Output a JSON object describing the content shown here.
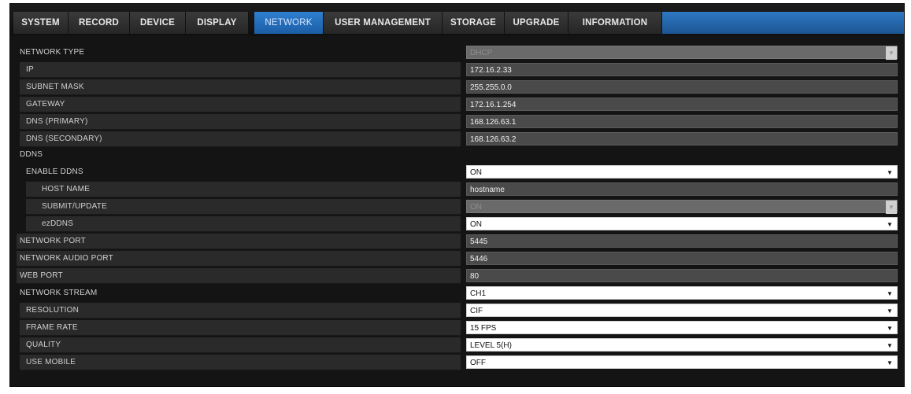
{
  "tabs": [
    {
      "label": "SYSTEM"
    },
    {
      "label": "RECORD"
    },
    {
      "label": "DEVICE"
    },
    {
      "label": "DISPLAY"
    },
    {
      "label": "NETWORK"
    },
    {
      "label": "USER MANAGEMENT"
    },
    {
      "label": "STORAGE"
    },
    {
      "label": "UPGRADE"
    },
    {
      "label": "INFORMATION"
    }
  ],
  "rows": [
    {
      "label": "NETWORK TYPE",
      "value": "DHCP",
      "kind": "select-disabled"
    },
    {
      "label": "IP",
      "value": "172.16.2.33",
      "kind": "text"
    },
    {
      "label": "SUBNET MASK",
      "value": "255.255.0.0",
      "kind": "text"
    },
    {
      "label": "GATEWAY",
      "value": "172.16.1.254",
      "kind": "text"
    },
    {
      "label": "DNS (PRIMARY)",
      "value": "168.126.63.1",
      "kind": "text"
    },
    {
      "label": "DNS (SECONDARY)",
      "value": "168.126.63.2",
      "kind": "text"
    },
    {
      "label": "DDNS",
      "value": "",
      "kind": "section"
    },
    {
      "label": "ENABLE DDNS",
      "value": "ON",
      "kind": "select"
    },
    {
      "label": "HOST NAME",
      "value": "hostname",
      "kind": "text"
    },
    {
      "label": "SUBMIT/UPDATE",
      "value": "ON",
      "kind": "select-disabled"
    },
    {
      "label": "ezDDNS",
      "value": "ON",
      "kind": "select"
    },
    {
      "label": "NETWORK PORT",
      "value": "5445",
      "kind": "text"
    },
    {
      "label": "NETWORK AUDIO PORT",
      "value": "5446",
      "kind": "text"
    },
    {
      "label": "WEB PORT",
      "value": "80",
      "kind": "text"
    },
    {
      "label": "NETWORK STREAM",
      "value": "CH1",
      "kind": "select"
    },
    {
      "label": "RESOLUTION",
      "value": "CIF",
      "kind": "select"
    },
    {
      "label": "FRAME RATE",
      "value": "15 FPS",
      "kind": "select"
    },
    {
      "label": "QUALITY",
      "value": "LEVEL 5(H)",
      "kind": "select"
    },
    {
      "label": "USE MOBILE",
      "value": "OFF",
      "kind": "select"
    }
  ],
  "colors": {
    "active_tab": "#2f7fcf",
    "panel": "#141414"
  }
}
